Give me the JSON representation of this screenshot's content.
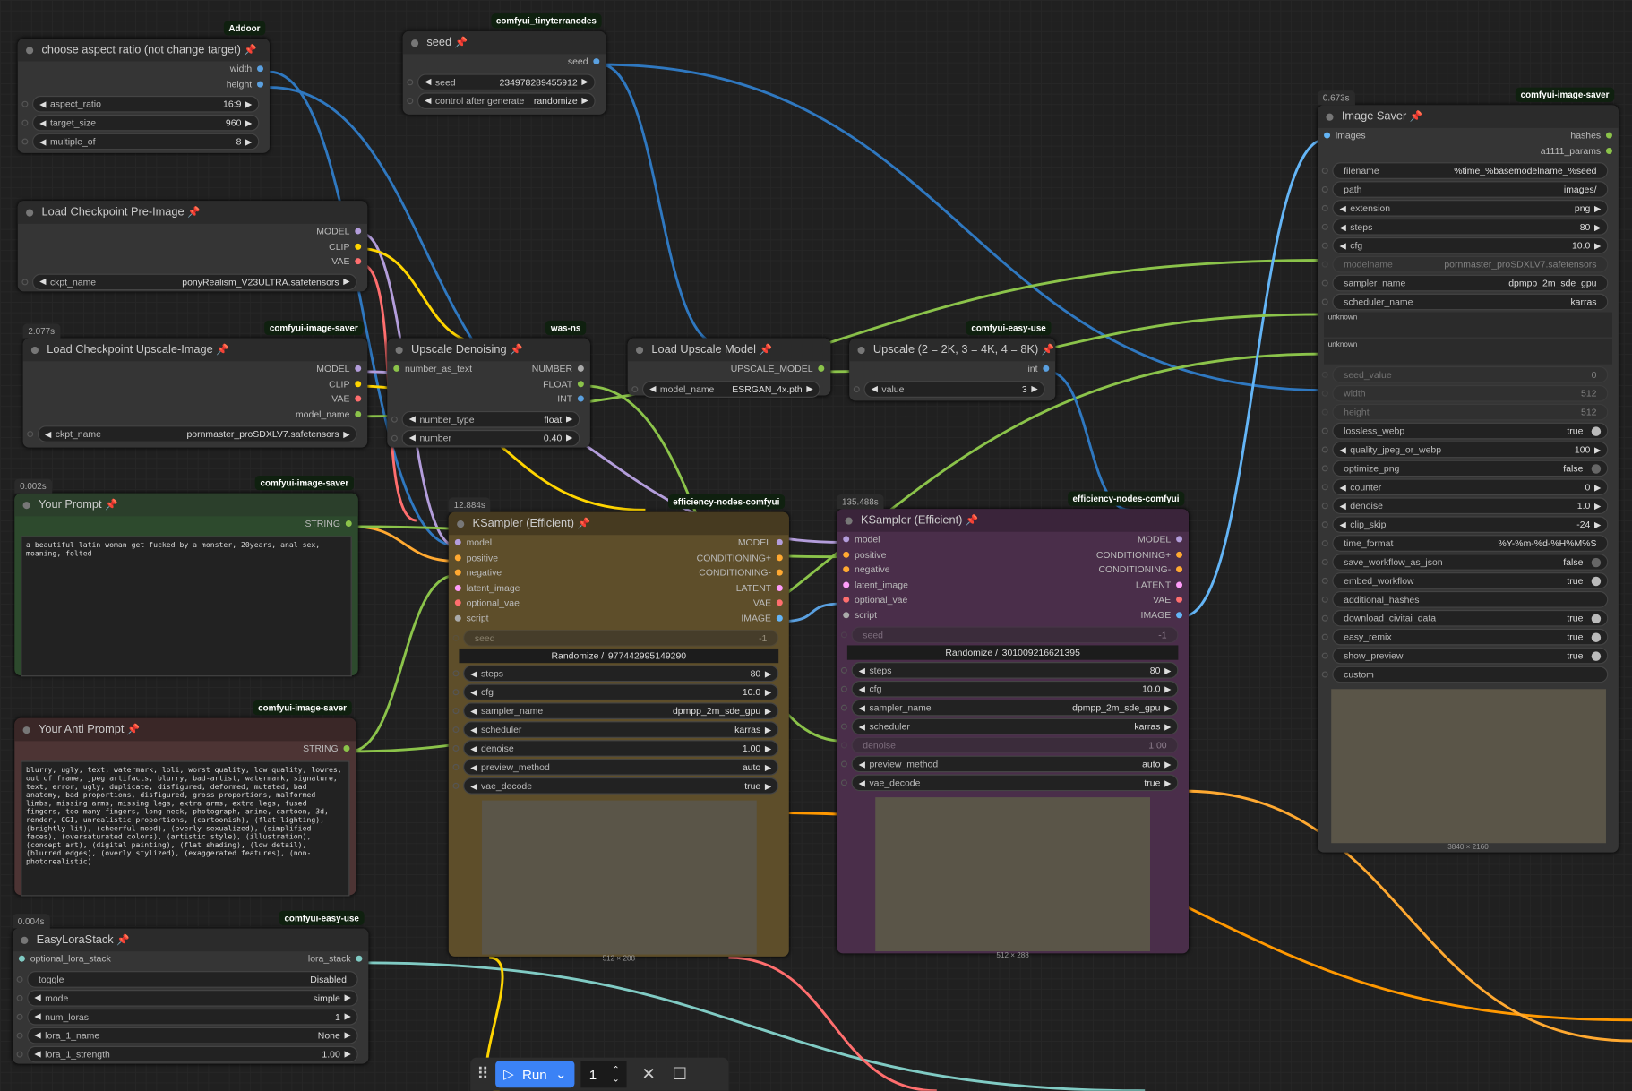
{
  "nodes": [
    {
      "id": "aspect",
      "title": "choose aspect ratio (not change target)",
      "badge": "Addoor",
      "inputs": [],
      "outputs": [
        {
          "n": "width",
          "c": "#5aa0e0"
        },
        {
          "n": "height",
          "c": "#5aa0e0"
        }
      ],
      "widgets": [
        {
          "label": "aspect_ratio",
          "value": "16:9",
          "kind": "arrow"
        },
        {
          "label": "target_size",
          "value": "960",
          "kind": "arrow"
        },
        {
          "label": "multiple_of",
          "value": "8",
          "kind": "arrow"
        }
      ]
    },
    {
      "id": "seed",
      "title": "seed",
      "badge": "comfyui_tinyterranodes",
      "inputs": [],
      "outputs": [
        {
          "n": "seed",
          "c": "#5aa0e0"
        }
      ],
      "widgets": [
        {
          "label": "seed",
          "value": "234978289455912",
          "kind": "arrow"
        },
        {
          "label": "control after generate",
          "value": "randomize",
          "kind": "arrow"
        }
      ]
    },
    {
      "id": "ckpt1",
      "title": "Load Checkpoint Pre-Image",
      "inputs": [],
      "outputs": [
        {
          "n": "MODEL",
          "c": "#b39ddb"
        },
        {
          "n": "CLIP",
          "c": "#ffd500"
        },
        {
          "n": "VAE",
          "c": "#ff6e6e"
        }
      ],
      "widgets": [
        {
          "label": "ckpt_name",
          "value": "ponyRealism_V23ULTRA.safetensors",
          "kind": "arrow"
        }
      ]
    },
    {
      "id": "ckpt2",
      "title": "Load Checkpoint Upscale-Image",
      "badge": "comfyui-image-saver",
      "timing": "2.077s",
      "inputs": [],
      "outputs": [
        {
          "n": "MODEL",
          "c": "#b39ddb"
        },
        {
          "n": "CLIP",
          "c": "#ffd500"
        },
        {
          "n": "VAE",
          "c": "#ff6e6e"
        },
        {
          "n": "model_name",
          "c": "#8bc34a"
        }
      ],
      "widgets": [
        {
          "label": "ckpt_name",
          "value": "pornmaster_proSDXLV7.safetensors",
          "kind": "arrow"
        }
      ]
    },
    {
      "id": "upden",
      "title": "Upscale Denoising",
      "badge": "was-ns",
      "inputs": [
        {
          "n": "number_as_text",
          "c": "#8bc34a"
        }
      ],
      "outputs": [
        {
          "n": "NUMBER",
          "c": "#aaa"
        },
        {
          "n": "FLOAT",
          "c": "#8bc34a"
        },
        {
          "n": "INT",
          "c": "#5aa0e0"
        }
      ],
      "widgets": [
        {
          "label": "number_type",
          "value": "float",
          "kind": "arrow"
        },
        {
          "label": "number",
          "value": "0.40",
          "kind": "arrow"
        }
      ]
    },
    {
      "id": "upmodel",
      "title": "Load Upscale Model",
      "inputs": [],
      "outputs": [
        {
          "n": "UPSCALE_MODEL",
          "c": "#8bc34a"
        }
      ],
      "widgets": [
        {
          "label": "model_name",
          "value": "ESRGAN_4x.pth",
          "kind": "arrow"
        }
      ]
    },
    {
      "id": "upscale",
      "title": "Upscale (2 = 2K, 3 = 4K, 4 = 8K)",
      "badge": "comfyui-easy-use",
      "inputs": [],
      "outputs": [
        {
          "n": "int",
          "c": "#5aa0e0"
        }
      ],
      "widgets": [
        {
          "label": "value",
          "value": "3",
          "kind": "arrow"
        }
      ]
    },
    {
      "id": "prompt",
      "title": "Your Prompt",
      "badge": "comfyui-image-saver",
      "timing": "0.002s",
      "inputs": [],
      "outputs": [
        {
          "n": "STRING",
          "c": "#8bc34a"
        }
      ],
      "widgets": [],
      "text": "a beautiful latin woman get fucked by a monster, 20years, anal sex, moaning, folted"
    },
    {
      "id": "anti",
      "title": "Your Anti Prompt",
      "badge": "comfyui-image-saver",
      "inputs": [],
      "outputs": [
        {
          "n": "STRING",
          "c": "#8bc34a"
        }
      ],
      "widgets": [],
      "text": "blurry, ugly, text, watermark, loli, worst quality, low quality, lowres, out of frame, jpeg artifacts, blurry, bad-artist, watermark, signature, text, error, ugly, duplicate, disfigured, deformed, mutated, bad anatomy, bad proportions, disfigured, gross proportions, malformed limbs, missing arms, missing legs, extra arms, extra legs, fused fingers, too many fingers, long neck, photograph, anime, cartoon, 3d, render, CGI, unrealistic proportions, (cartoonish), (flat lighting), (brightly lit), (cheerful mood), (overly sexualized), (simplified faces), (oversaturated colors), (artistic style), (illustration), (concept art), (digital painting), (flat shading), (low detail), (blurred edges), (overly stylized), (exaggerated features), (non-photorealistic)"
    },
    {
      "id": "lora",
      "title": "EasyLoraStack",
      "badge": "comfyui-easy-use",
      "timing": "0.004s",
      "inputs": [
        {
          "n": "optional_lora_stack",
          "c": "#80cbc4"
        }
      ],
      "outputs": [
        {
          "n": "lora_stack",
          "c": "#80cbc4"
        }
      ],
      "widgets": [
        {
          "label": "toggle",
          "value": "Disabled",
          "kind": "text"
        },
        {
          "label": "mode",
          "value": "simple",
          "kind": "arrow"
        },
        {
          "label": "num_loras",
          "value": "1",
          "kind": "arrow"
        },
        {
          "label": "lora_1_name",
          "value": "None",
          "kind": "arrow"
        },
        {
          "label": "lora_1_strength",
          "value": "1.00",
          "kind": "arrow"
        }
      ]
    },
    {
      "id": "ks1",
      "title": "KSampler (Efficient)",
      "badge": "efficiency-nodes-comfyui",
      "timing": "12.884s",
      "inputs": [
        {
          "n": "model",
          "c": "#b39ddb"
        },
        {
          "n": "positive",
          "c": "#ffa931"
        },
        {
          "n": "negative",
          "c": "#ffa931"
        },
        {
          "n": "latent_image",
          "c": "#ff9cf9"
        },
        {
          "n": "optional_vae",
          "c": "#ff6e6e"
        },
        {
          "n": "script",
          "c": "#aaa"
        }
      ],
      "outputs": [
        {
          "n": "MODEL",
          "c": "#b39ddb"
        },
        {
          "n": "CONDITIONING+",
          "c": "#ffa931"
        },
        {
          "n": "CONDITIONING-",
          "c": "#ffa931"
        },
        {
          "n": "LATENT",
          "c": "#ff9cf9"
        },
        {
          "n": "VAE",
          "c": "#ff6e6e"
        },
        {
          "n": "IMAGE",
          "c": "#64b5f6"
        }
      ],
      "widgets": [
        {
          "label": "seed",
          "value": "-1",
          "kind": "disabled"
        },
        {
          "label": "Randomize / ",
          "value": "977442995149290",
          "kind": "randomize"
        },
        {
          "label": "steps",
          "value": "80",
          "kind": "arrow"
        },
        {
          "label": "cfg",
          "value": "10.0",
          "kind": "arrow"
        },
        {
          "label": "sampler_name",
          "value": "dpmpp_2m_sde_gpu",
          "kind": "arrow"
        },
        {
          "label": "scheduler",
          "value": "karras",
          "kind": "arrow"
        },
        {
          "label": "denoise",
          "value": "1.00",
          "kind": "arrow"
        },
        {
          "label": "preview_method",
          "value": "auto",
          "kind": "arrow"
        },
        {
          "label": "vae_decode",
          "value": "true",
          "kind": "arrow"
        }
      ],
      "image_dims": "512 × 288"
    },
    {
      "id": "ks2",
      "title": "KSampler (Efficient)",
      "badge": "efficiency-nodes-comfyui",
      "timing": "135.488s",
      "inputs": [
        {
          "n": "model",
          "c": "#b39ddb"
        },
        {
          "n": "positive",
          "c": "#ffa931"
        },
        {
          "n": "negative",
          "c": "#ffa931"
        },
        {
          "n": "latent_image",
          "c": "#ff9cf9"
        },
        {
          "n": "optional_vae",
          "c": "#ff6e6e"
        },
        {
          "n": "script",
          "c": "#aaa"
        }
      ],
      "outputs": [
        {
          "n": "MODEL",
          "c": "#b39ddb"
        },
        {
          "n": "CONDITIONING+",
          "c": "#ffa931"
        },
        {
          "n": "CONDITIONING-",
          "c": "#ffa931"
        },
        {
          "n": "LATENT",
          "c": "#ff9cf9"
        },
        {
          "n": "VAE",
          "c": "#ff6e6e"
        },
        {
          "n": "IMAGE",
          "c": "#64b5f6"
        }
      ],
      "widgets": [
        {
          "label": "seed",
          "value": "-1",
          "kind": "disabled"
        },
        {
          "label": "Randomize / ",
          "value": "301009216621395",
          "kind": "randomize"
        },
        {
          "label": "steps",
          "value": "80",
          "kind": "arrow"
        },
        {
          "label": "cfg",
          "value": "10.0",
          "kind": "arrow"
        },
        {
          "label": "sampler_name",
          "value": "dpmpp_2m_sde_gpu",
          "kind": "arrow"
        },
        {
          "label": "scheduler",
          "value": "karras",
          "kind": "arrow"
        },
        {
          "label": "denoise",
          "value": "1.00",
          "kind": "disabled"
        },
        {
          "label": "preview_method",
          "value": "auto",
          "kind": "arrow"
        },
        {
          "label": "vae_decode",
          "value": "true",
          "kind": "arrow"
        }
      ],
      "image_dims": "512 × 288"
    },
    {
      "id": "saver",
      "title": "Image Saver",
      "badge": "comfyui-image-saver",
      "timing": "0.673s",
      "inputs": [
        {
          "n": "images",
          "c": "#64b5f6"
        },
        {
          "n": "",
          "c": ""
        }
      ],
      "outputs": [
        {
          "n": "hashes",
          "c": "#8bc34a"
        },
        {
          "n": "a1111_params",
          "c": "#8bc34a"
        }
      ],
      "widgets": [
        {
          "label": "filename",
          "value": "%time_%basemodelname_%seed",
          "kind": "text"
        },
        {
          "label": "path",
          "value": "images/",
          "kind": "text"
        },
        {
          "label": "extension",
          "value": "png",
          "kind": "arrow"
        },
        {
          "label": "steps",
          "value": "80",
          "kind": "arrow"
        },
        {
          "label": "cfg",
          "value": "10.0",
          "kind": "arrow"
        },
        {
          "label": "modelname",
          "value": "pornmaster_proSDXLV7.safetensors",
          "kind": "disabled"
        },
        {
          "label": "sampler_name",
          "value": "dpmpp_2m_sde_gpu",
          "kind": "text"
        },
        {
          "label": "scheduler_name",
          "value": "karras",
          "kind": "text"
        },
        {
          "label": "unknown",
          "value": "",
          "kind": "unknown"
        },
        {
          "label": "unknown",
          "value": "",
          "kind": "unknown"
        },
        {
          "label": "seed_value",
          "value": "0",
          "kind": "disabled"
        },
        {
          "label": "width",
          "value": "512",
          "kind": "disabled"
        },
        {
          "label": "height",
          "value": "512",
          "kind": "disabled"
        },
        {
          "label": "lossless_webp",
          "value": "true",
          "kind": "toggle"
        },
        {
          "label": "quality_jpeg_or_webp",
          "value": "100",
          "kind": "arrow"
        },
        {
          "label": "optimize_png",
          "value": "false",
          "kind": "toggle"
        },
        {
          "label": "counter",
          "value": "0",
          "kind": "arrow"
        },
        {
          "label": "denoise",
          "value": "1.0",
          "kind": "arrow"
        },
        {
          "label": "clip_skip",
          "value": "-24",
          "kind": "arrow"
        },
        {
          "label": "time_format",
          "value": "%Y-%m-%d-%H%M%S",
          "kind": "text"
        },
        {
          "label": "save_workflow_as_json",
          "value": "false",
          "kind": "toggle"
        },
        {
          "label": "embed_workflow",
          "value": "true",
          "kind": "toggle"
        },
        {
          "label": "additional_hashes",
          "value": "",
          "kind": "text"
        },
        {
          "label": "download_civitai_data",
          "value": "true",
          "kind": "toggle"
        },
        {
          "label": "easy_remix",
          "value": "true",
          "kind": "toggle"
        },
        {
          "label": "show_preview",
          "value": "true",
          "kind": "toggle"
        },
        {
          "label": "custom",
          "value": "",
          "kind": "text"
        }
      ],
      "image_dims": "3840 × 2160"
    }
  ],
  "toolbar": {
    "run_label": "Run",
    "batch_count": "1"
  }
}
